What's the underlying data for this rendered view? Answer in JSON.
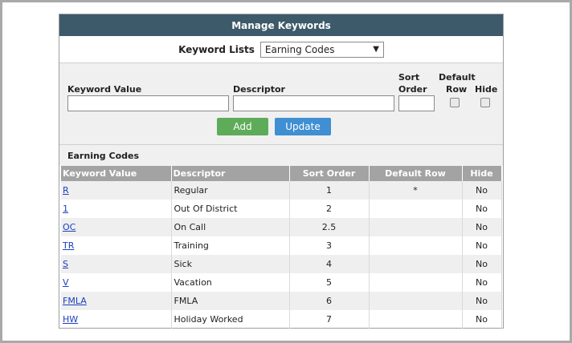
{
  "header": {
    "title": "Manage Keywords"
  },
  "keyword_lists": {
    "label": "Keyword Lists",
    "selected": "Earning Codes"
  },
  "form": {
    "keyword_value_label": "Keyword Value",
    "descriptor_label": "Descriptor",
    "sort_label_1": "Sort",
    "sort_label_2": "Order",
    "default_label_1": "Default",
    "default_label_2": "Row",
    "hide_label": "Hide",
    "add_button": "Add",
    "update_button": "Update"
  },
  "table": {
    "section_title": "Earning Codes",
    "columns": [
      "Keyword Value",
      "Descriptor",
      "Sort Order",
      "Default Row",
      "Hide"
    ],
    "rows": [
      {
        "keyword": "R",
        "descriptor": "Regular",
        "sort": "1",
        "default": "*",
        "hide": "No"
      },
      {
        "keyword": "1",
        "descriptor": "Out Of District",
        "sort": "2",
        "default": "",
        "hide": "No"
      },
      {
        "keyword": "OC",
        "descriptor": "On Call",
        "sort": "2.5",
        "default": "",
        "hide": "No"
      },
      {
        "keyword": "TR",
        "descriptor": "Training",
        "sort": "3",
        "default": "",
        "hide": "No"
      },
      {
        "keyword": "S",
        "descriptor": "Sick",
        "sort": "4",
        "default": "",
        "hide": "No"
      },
      {
        "keyword": "V",
        "descriptor": "Vacation",
        "sort": "5",
        "default": "",
        "hide": "No"
      },
      {
        "keyword": "FMLA",
        "descriptor": "FMLA",
        "sort": "6",
        "default": "",
        "hide": "No"
      },
      {
        "keyword": "HW",
        "descriptor": "Holiday Worked",
        "sort": "7",
        "default": "",
        "hide": "No"
      }
    ]
  },
  "icons": {
    "dropdown": "caret-down-icon"
  },
  "colors": {
    "header": "#3d5a6a",
    "add": "#5eac5a",
    "update": "#3f8fd2",
    "link": "#1a3fbf"
  }
}
